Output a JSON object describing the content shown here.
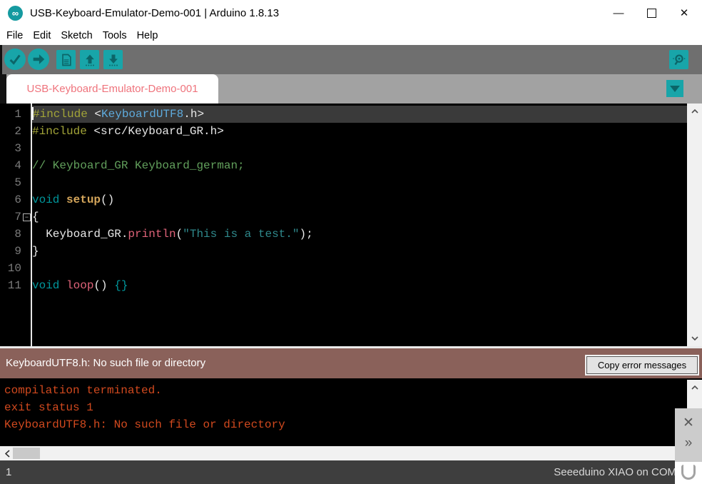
{
  "colors": {
    "accent_teal": "#00979C",
    "toolbar_bg": "#6F6F6F",
    "tabbar_bg": "#A2A2A2",
    "tab_text_pink": "#EF737C",
    "editor_bg": "#000000",
    "highlight_row": "#3A3A3A",
    "preprocessor": "#A2A438",
    "include_lib_blue": "#5EAADC",
    "comment_green": "#62A05C",
    "keyword_teal": "#00979C",
    "function_gold": "#D5A65B",
    "method_pink": "#DF6379",
    "string_teal": "#2F898C",
    "error_banner_bg": "#8A615A",
    "console_text": "#D1491E",
    "status_bg": "#3E3E3E"
  },
  "window": {
    "title": "USB-Keyboard-Emulator-Demo-001 | Arduino 1.8.13",
    "logo_glyph": "∞",
    "minimize_glyph": "—",
    "close_glyph": "✕"
  },
  "menu": {
    "items": [
      "File",
      "Edit",
      "Sketch",
      "Tools",
      "Help"
    ]
  },
  "toolbar": {
    "buttons": [
      "verify",
      "upload",
      "new",
      "open",
      "save",
      "serial-monitor"
    ]
  },
  "tabbar": {
    "active_tab": "USB-Keyboard-Emulator-Demo-001"
  },
  "editor": {
    "lines": [
      {
        "num": "1",
        "highlight": true,
        "cursor": true,
        "segments": [
          {
            "text": "#include",
            "cls": "preproc"
          },
          {
            "text": " <",
            "cls": "plain"
          },
          {
            "text": "KeyboardUTF8",
            "cls": "lib"
          },
          {
            "text": ".h>",
            "cls": "plain"
          }
        ]
      },
      {
        "num": "2",
        "segments": [
          {
            "text": "#include",
            "cls": "preproc"
          },
          {
            "text": " <src/Keyboard_GR.h>",
            "cls": "plain"
          }
        ]
      },
      {
        "num": "3",
        "segments": []
      },
      {
        "num": "4",
        "segments": [
          {
            "text": "// Keyboard_GR Keyboard_german;",
            "cls": "comment"
          }
        ]
      },
      {
        "num": "5",
        "segments": []
      },
      {
        "num": "6",
        "segments": [
          {
            "text": "void",
            "cls": "keyword"
          },
          {
            "text": " ",
            "cls": "plain"
          },
          {
            "text": "setup",
            "cls": "func"
          },
          {
            "text": "()",
            "cls": "plain"
          }
        ]
      },
      {
        "num": "7",
        "fold": true,
        "segments": [
          {
            "text": "{",
            "cls": "plain"
          }
        ]
      },
      {
        "num": "8",
        "segments": [
          {
            "text": "  Keyboard_GR.",
            "cls": "plain"
          },
          {
            "text": "println",
            "cls": "method"
          },
          {
            "text": "(",
            "cls": "plain"
          },
          {
            "text": "\"This is a test.\"",
            "cls": "string"
          },
          {
            "text": ")",
            "cls": "plain"
          },
          {
            "text": ";",
            "cls": "plain"
          }
        ]
      },
      {
        "num": "9",
        "segments": [
          {
            "text": "}",
            "cls": "plain"
          }
        ]
      },
      {
        "num": "10",
        "segments": []
      },
      {
        "num": "11",
        "segments": [
          {
            "text": "void",
            "cls": "keyword"
          },
          {
            "text": " ",
            "cls": "plain"
          },
          {
            "text": "loop",
            "cls": "method"
          },
          {
            "text": "() ",
            "cls": "plain"
          },
          {
            "text": "{}",
            "cls": "keyword"
          }
        ]
      }
    ]
  },
  "error_banner": {
    "message": "KeyboardUTF8.h: No such file or directory",
    "copy_button": "Copy error messages"
  },
  "console": {
    "lines": [
      "compilation terminated.",
      "exit status 1",
      "KeyboardUTF8.h: No such file or directory"
    ]
  },
  "side_panel": {
    "close_glyph": "✕",
    "expand_glyph": "»"
  },
  "status_bar": {
    "line_number": "1",
    "board_info": "Seeeduino XIAO on COM"
  }
}
